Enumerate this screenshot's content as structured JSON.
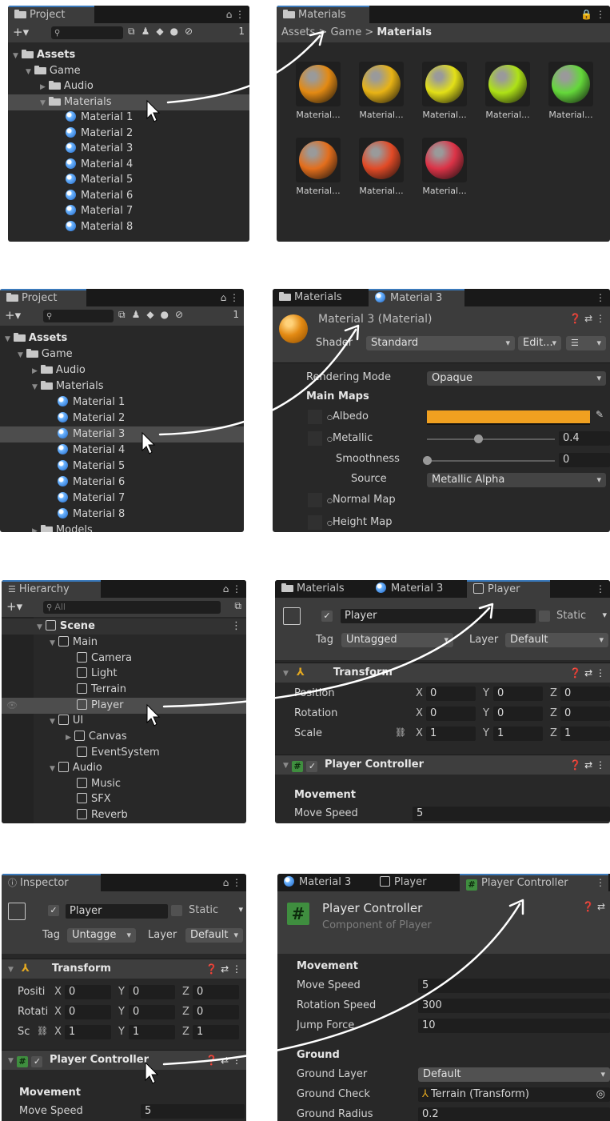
{
  "panel1": {
    "tab": "Project",
    "count": "1",
    "tree": [
      "Assets",
      "Game",
      "Audio",
      "Materials",
      "Material 1",
      "Material 2",
      "Material 3",
      "Material 4",
      "Material 5",
      "Material 6",
      "Material 7",
      "Material 8"
    ]
  },
  "panel2": {
    "tab": "Materials",
    "breadcrumb": {
      "assets": "Assets",
      "game": "Game",
      "materials": "Materials"
    },
    "ball_label": "Material...",
    "ball_colors": [
      "#e38a13",
      "#e8b315",
      "#e3e017",
      "#aee216",
      "#64d83a",
      "#e36e1c",
      "#e24a26",
      "#dc3347"
    ]
  },
  "panel3": {
    "tab": "Project",
    "count": "1",
    "tree": [
      "Assets",
      "Game",
      "Audio",
      "Materials",
      "Material 1",
      "Material 2",
      "Material 3",
      "Material 4",
      "Material 5",
      "Material 6",
      "Material 7",
      "Material 8",
      "Models"
    ]
  },
  "panel4": {
    "tabs": {
      "materials": "Materials",
      "material3": "Material 3"
    },
    "title": "Material 3 (Material)",
    "shader_label": "Shader",
    "shader_value": "Standard",
    "edit_label": "Edit...",
    "rows": {
      "rendering_mode_label": "Rendering Mode",
      "rendering_mode_value": "Opaque",
      "main_maps": "Main Maps",
      "albedo": "Albedo",
      "albedo_color": "#f0a020",
      "metallic": "Metallic",
      "metallic_value": "0.4",
      "smoothness": "Smoothness",
      "smoothness_value": "0",
      "source": "Source",
      "source_value": "Metallic Alpha",
      "normal_map": "Normal Map",
      "height_map": "Height Map"
    }
  },
  "panel5": {
    "tab": "Hierarchy",
    "search_placeholder": "All",
    "tree": [
      "Scene",
      "Main",
      "Camera",
      "Light",
      "Terrain",
      "Player",
      "UI",
      "Canvas",
      "EventSystem",
      "Audio",
      "Music",
      "SFX",
      "Reverb"
    ]
  },
  "panel6": {
    "tabs": {
      "materials": "Materials",
      "material3": "Material 3",
      "player": "Player"
    },
    "name": "Player",
    "static": "Static",
    "tag_label": "Tag",
    "tag_value": "Untagged",
    "layer_label": "Layer",
    "layer_value": "Default",
    "transform": "Transform",
    "position": "Position",
    "rotation": "Rotation",
    "scale": "Scale",
    "axes": {
      "x": "X",
      "y": "Y",
      "z": "Z"
    },
    "pos": [
      "0",
      "0",
      "0"
    ],
    "rot": [
      "0",
      "0",
      "0"
    ],
    "scl": [
      "1",
      "1",
      "1"
    ],
    "controller": "Player Controller",
    "movement": "Movement",
    "move_speed": "Move Speed",
    "move_speed_value": "5"
  },
  "panel7": {
    "tab": "Inspector",
    "name": "Player",
    "static": "Static",
    "tag_label": "Tag",
    "tag_value": "Untagge",
    "layer_label": "Layer",
    "layer_value": "Default",
    "transform": "Transform",
    "position": "Positi",
    "rotation": "Rotati",
    "scale": "Sc",
    "axes": {
      "x": "X",
      "y": "Y",
      "z": "Z"
    },
    "pos": [
      "0",
      "0",
      "0"
    ],
    "rot": [
      "0",
      "0",
      "0"
    ],
    "scl": [
      "1",
      "1",
      "1"
    ],
    "controller": "Player Controller",
    "movement": "Movement",
    "move_speed": "Move Speed",
    "move_speed_value": "5"
  },
  "panel8": {
    "tabs": {
      "material3": "Material 3",
      "player": "Player",
      "controller": "Player Controller"
    },
    "title": "Player Controller",
    "subtitle": "Component of Player",
    "movement": "Movement",
    "move_speed": "Move Speed",
    "move_speed_value": "5",
    "rotation_speed": "Rotation Speed",
    "rotation_speed_value": "300",
    "jump_force": "Jump Force",
    "jump_force_value": "10",
    "ground": "Ground",
    "ground_layer": "Ground Layer",
    "ground_layer_value": "Default",
    "ground_check": "Ground Check",
    "ground_check_value": "Terrain (Transform)",
    "ground_radius": "Ground Radius",
    "ground_radius_value": "0.2"
  }
}
